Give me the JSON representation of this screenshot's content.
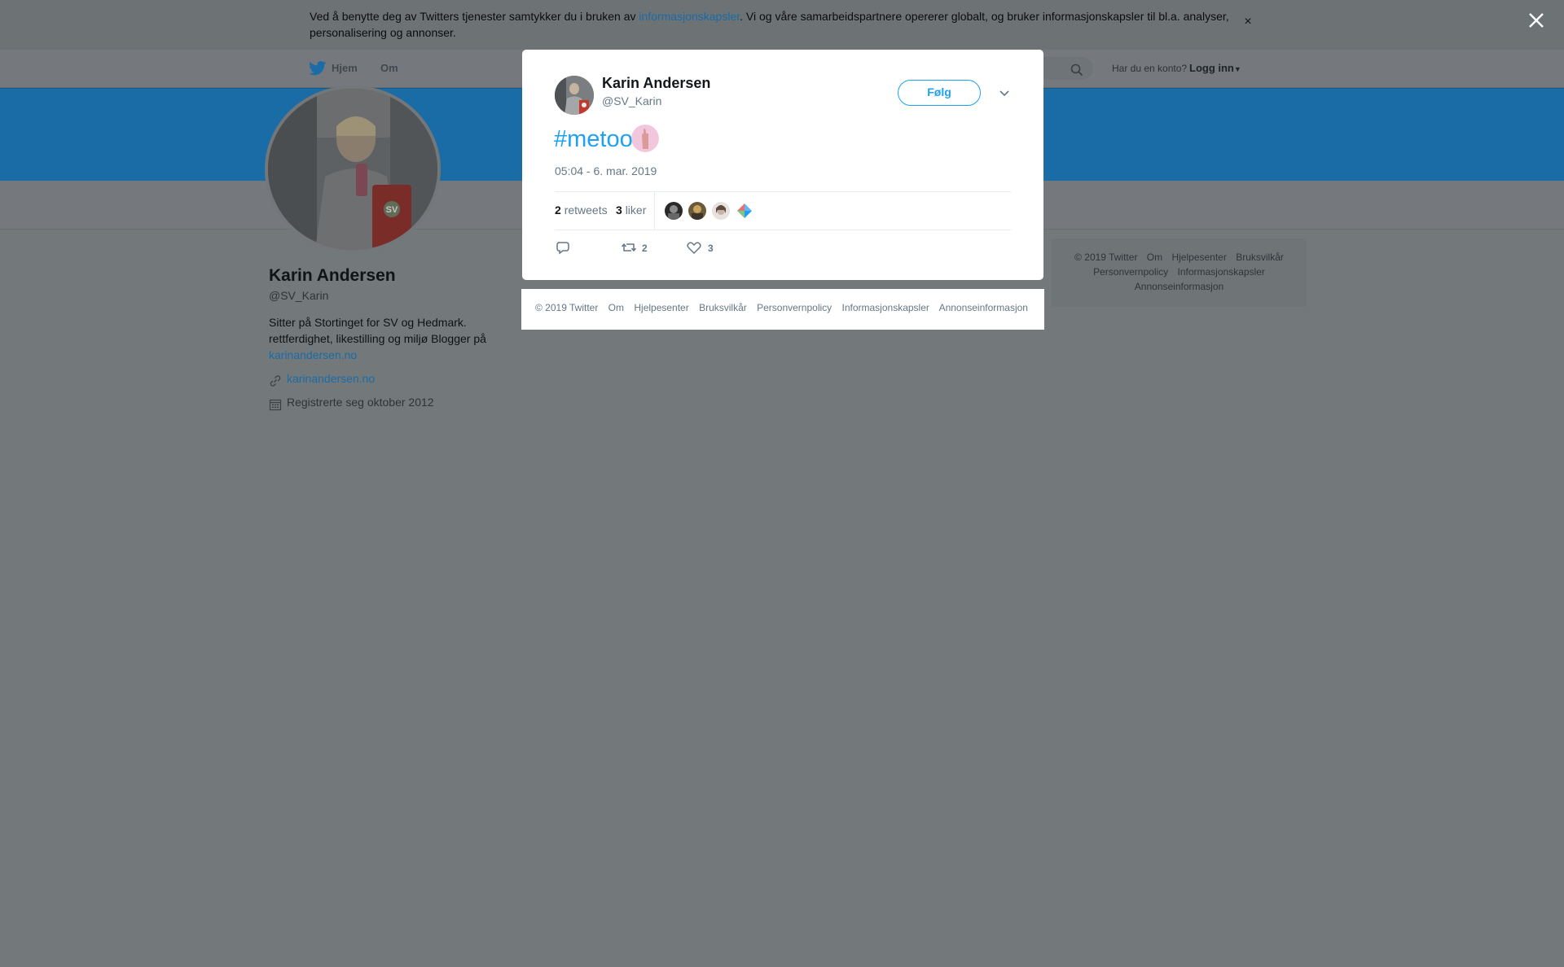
{
  "cookie": {
    "text_before": "Ved å benytte deg av Twitters tjenester samtykker du i bruken av ",
    "link": "informasjonskapsler",
    "text_after": ". Vi og våre samarbeidspartnere opererer globalt, og bruker informasjonskapsler til bl.a. analyser, personalisering og annonser.",
    "close": "×"
  },
  "nav": {
    "home": "Hjem",
    "about": "Om",
    "account_question": "Har du en konto?",
    "login": "Logg inn"
  },
  "profile": {
    "name": "Karin Andersen",
    "handle": "@SV_Karin",
    "bio_text": "Sitter på Stortinget for SV og Hedmark. rettferdighet, likestilling og miljø Blogger på ",
    "bio_link": "karinandersen.no",
    "website": "karinandersen.no",
    "joined": "Registrerte seg oktober 2012",
    "party_badge": "SV"
  },
  "side_footer": {
    "items": [
      "© 2019 Twitter",
      "Om",
      "Hjelpesenter",
      "Bruksvilkår",
      "Personvernpolicy",
      "Informasjonskapsler",
      "Annonseinformasjon"
    ]
  },
  "tweet": {
    "name": "Karin Andersen",
    "handle": "@SV_Karin",
    "follow": "Følg",
    "text": "#metoo",
    "timestamp": "05:04 - 6. mar. 2019",
    "retweets_count": "2",
    "retweets_label": "retweets",
    "likes_count": "3",
    "likes_label": "liker",
    "action_retweets": "2",
    "action_likes": "3"
  },
  "modal_footer": {
    "items": [
      "© 2019 Twitter",
      "Om",
      "Hjelpesenter",
      "Bruksvilkår",
      "Personvernpolicy",
      "Informasjonskapsler",
      "Annonseinformasjon"
    ]
  },
  "colors": {
    "twitter_blue": "#1da1f2",
    "link_blue": "#2b7bb9",
    "overlay": "#73787b"
  }
}
